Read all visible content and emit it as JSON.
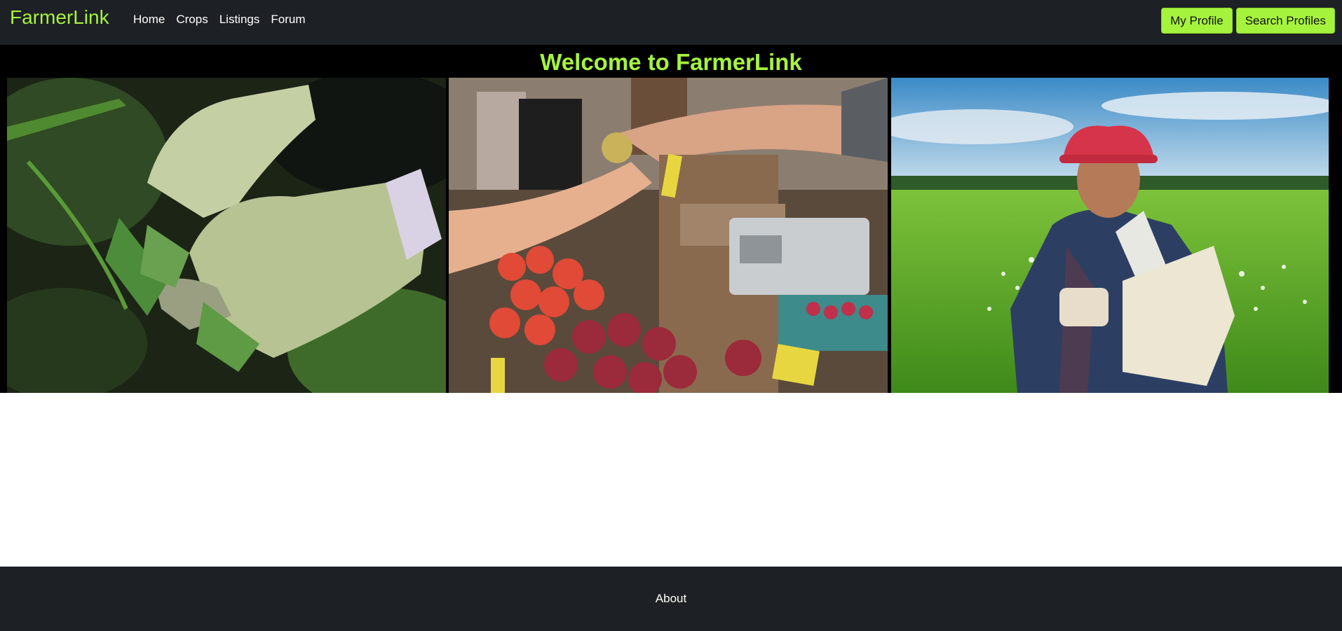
{
  "nav": {
    "brand": "FarmerLink",
    "links": [
      "Home",
      "Crops",
      "Listings",
      "Forum"
    ],
    "buttons": {
      "profile": "My Profile",
      "search": "Search Profiles"
    }
  },
  "hero": {
    "title": "Welcome to FarmerLink",
    "images": [
      {
        "alt": "gloved hands holding fresh herbs"
      },
      {
        "alt": "hand passing fruit at farmers market stall"
      },
      {
        "alt": "farmer sowing seeds in green field"
      }
    ]
  },
  "footer": {
    "about": "About"
  },
  "colors": {
    "accent": "#a6f33e",
    "nav_bg": "#1d2024",
    "hero_bg": "#000000"
  }
}
